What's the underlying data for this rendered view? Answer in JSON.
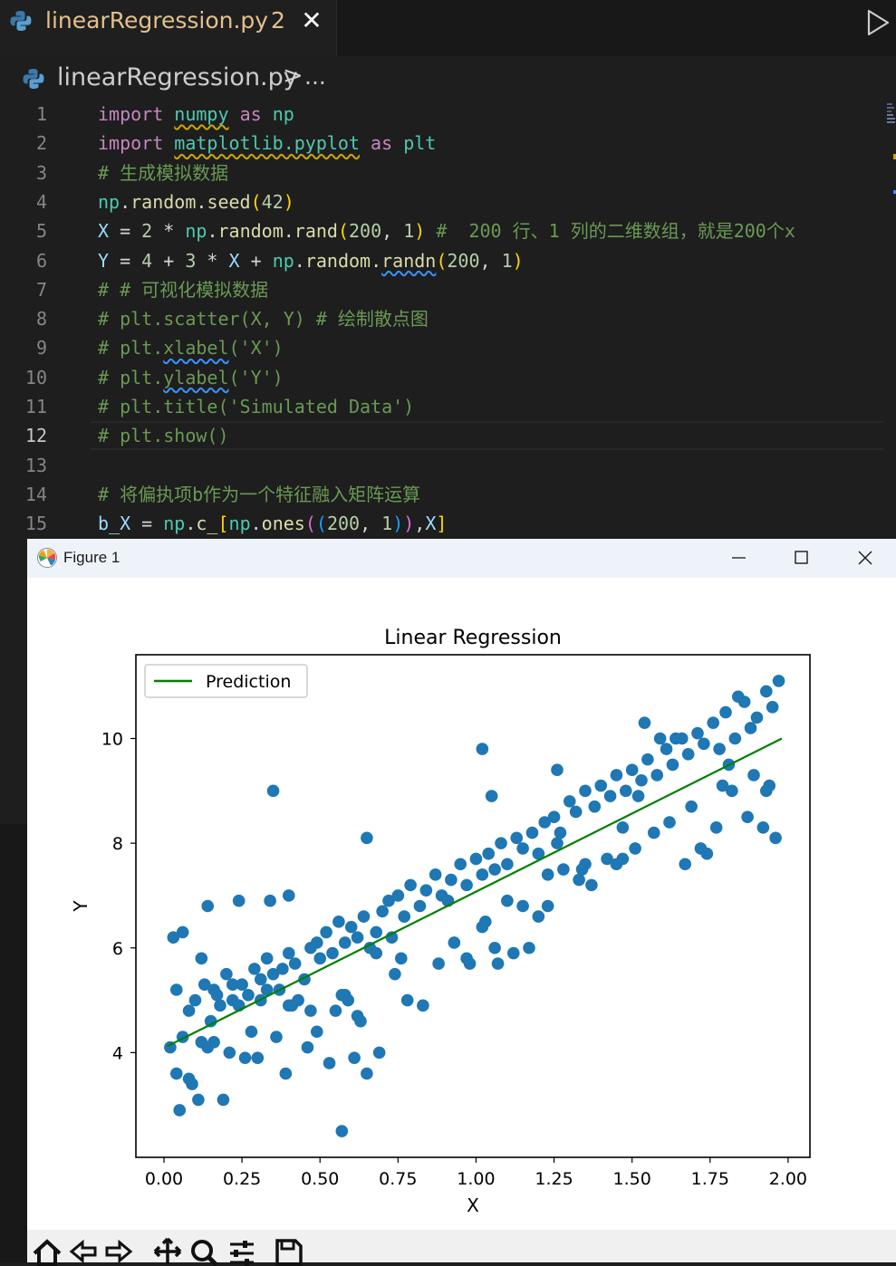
{
  "editor": {
    "tab": {
      "title": "linearRegression.py",
      "badge": "2",
      "close": "✕"
    },
    "breadcrumb": {
      "file": "linearRegression.py",
      "separator": ">",
      "ellipsis": "..."
    },
    "active_line": "12",
    "lines": [
      {
        "n": "1",
        "s": [
          [
            "kw",
            "import"
          ],
          [
            "op",
            " "
          ],
          [
            "mod sqy",
            "numpy"
          ],
          [
            "op",
            " "
          ],
          [
            "kw",
            "as"
          ],
          [
            "op",
            " "
          ],
          [
            "mod",
            "np"
          ]
        ]
      },
      {
        "n": "2",
        "s": [
          [
            "kw",
            "import"
          ],
          [
            "op",
            " "
          ],
          [
            "mod sqy",
            "matplotlib.pyplot"
          ],
          [
            "op",
            " "
          ],
          [
            "kw",
            "as"
          ],
          [
            "op",
            " "
          ],
          [
            "mod",
            "plt"
          ]
        ]
      },
      {
        "n": "3",
        "s": [
          [
            "cmt",
            "# 生成模拟数据"
          ]
        ]
      },
      {
        "n": "4",
        "s": [
          [
            "mod",
            "np"
          ],
          [
            "op",
            "."
          ],
          [
            "fn",
            "random"
          ],
          [
            "op",
            "."
          ],
          [
            "fn",
            "seed"
          ],
          [
            "b1",
            "("
          ],
          [
            "num",
            "42"
          ],
          [
            "b1",
            ")"
          ]
        ]
      },
      {
        "n": "5",
        "s": [
          [
            "var",
            "X"
          ],
          [
            "op",
            " = "
          ],
          [
            "num",
            "2"
          ],
          [
            "op",
            " * "
          ],
          [
            "mod",
            "np"
          ],
          [
            "op",
            "."
          ],
          [
            "fn",
            "random"
          ],
          [
            "op",
            "."
          ],
          [
            "fn",
            "rand"
          ],
          [
            "b1",
            "("
          ],
          [
            "num",
            "200"
          ],
          [
            "op",
            ", "
          ],
          [
            "num",
            "1"
          ],
          [
            "b1",
            ")"
          ],
          [
            "cmt",
            " #  200 行、1 列的二维数组，就是200个x"
          ]
        ]
      },
      {
        "n": "6",
        "s": [
          [
            "var",
            "Y"
          ],
          [
            "op",
            " = "
          ],
          [
            "num",
            "4"
          ],
          [
            "op",
            " + "
          ],
          [
            "num",
            "3"
          ],
          [
            "op",
            " * "
          ],
          [
            "var",
            "X"
          ],
          [
            "op",
            " + "
          ],
          [
            "mod",
            "np"
          ],
          [
            "op",
            "."
          ],
          [
            "fn",
            "random"
          ],
          [
            "op",
            "."
          ],
          [
            "fn sqb",
            "randn"
          ],
          [
            "b1",
            "("
          ],
          [
            "num",
            "200"
          ],
          [
            "op",
            ", "
          ],
          [
            "num",
            "1"
          ],
          [
            "b1",
            ")"
          ]
        ]
      },
      {
        "n": "7",
        "s": [
          [
            "cmt",
            "# # 可视化模拟数据"
          ]
        ]
      },
      {
        "n": "8",
        "s": [
          [
            "cmt",
            "# plt.scatter(X, Y) # 绘制散点图"
          ]
        ]
      },
      {
        "n": "9",
        "s": [
          [
            "cmt",
            "# plt."
          ],
          [
            "cmt sqb",
            "xlabel"
          ],
          [
            "cmt",
            "('X')"
          ]
        ]
      },
      {
        "n": "10",
        "s": [
          [
            "cmt",
            "# plt."
          ],
          [
            "cmt sqb",
            "ylabel"
          ],
          [
            "cmt",
            "('Y')"
          ]
        ]
      },
      {
        "n": "11",
        "s": [
          [
            "cmt",
            "# plt.title('Simulated Data')"
          ]
        ]
      },
      {
        "n": "12",
        "s": [
          [
            "cmt",
            "# plt.show()"
          ]
        ]
      },
      {
        "n": "13",
        "s": []
      },
      {
        "n": "14",
        "s": [
          [
            "cmt",
            "# 将偏执项b作为一个特征融入矩阵运算"
          ]
        ]
      },
      {
        "n": "15",
        "s": [
          [
            "var",
            "b_X"
          ],
          [
            "op",
            " = "
          ],
          [
            "mod",
            "np"
          ],
          [
            "op",
            "."
          ],
          [
            "fn",
            "c_"
          ],
          [
            "b1",
            "["
          ],
          [
            "mod",
            "np"
          ],
          [
            "op",
            "."
          ],
          [
            "fn",
            "ones"
          ],
          [
            "b2",
            "("
          ],
          [
            "b3",
            "("
          ],
          [
            "num",
            "200"
          ],
          [
            "op",
            ", "
          ],
          [
            "num",
            "1"
          ],
          [
            "b3",
            ")"
          ],
          [
            "b2",
            ")"
          ],
          [
            "op",
            ","
          ],
          [
            "var",
            "X"
          ],
          [
            "b1",
            "]"
          ]
        ]
      }
    ]
  },
  "figure": {
    "window_title": "Figure 1",
    "minimize": "—",
    "maximize": "☐",
    "close": "✕",
    "toolbar": [
      "home-icon",
      "back-icon",
      "forward-icon",
      "pan-icon",
      "zoom-icon",
      "configure-icon",
      "save-icon"
    ]
  },
  "chart_data": {
    "type": "scatter",
    "title": "Linear Regression",
    "xlabel": "X",
    "ylabel": "Y",
    "xlim": [
      -0.09,
      2.07
    ],
    "ylim": [
      2.0,
      11.6
    ],
    "xticks": [
      "0.00",
      "0.25",
      "0.50",
      "0.75",
      "1.00",
      "1.25",
      "1.50",
      "1.75",
      "2.00"
    ],
    "yticks": [
      "4",
      "6",
      "8",
      "10"
    ],
    "legend": {
      "entries": [
        "Prediction"
      ],
      "position": "upper left"
    },
    "colors": {
      "points": "#1f77b4",
      "line": "#008000"
    },
    "series": [
      {
        "type": "line",
        "name": "Prediction",
        "x": [
          0.01,
          1.98
        ],
        "y": [
          4.12,
          10.0
        ]
      },
      {
        "type": "scatter",
        "x": [
          0.02,
          0.04,
          0.06,
          0.08,
          0.1,
          0.12,
          0.13,
          0.15,
          0.17,
          0.18,
          0.2,
          0.22,
          0.24,
          0.25,
          0.27,
          0.29,
          0.31,
          0.33,
          0.35,
          0.37,
          0.38,
          0.4,
          0.42,
          0.45,
          0.47,
          0.49,
          0.5,
          0.52,
          0.54,
          0.56,
          0.58,
          0.6,
          0.62,
          0.64,
          0.66,
          0.68,
          0.7,
          0.72,
          0.75,
          0.77,
          0.79,
          0.82,
          0.84,
          0.87,
          0.89,
          0.92,
          0.95,
          0.97,
          1.0,
          1.02,
          1.04,
          1.06,
          1.08,
          1.1,
          1.13,
          1.15,
          1.18,
          1.2,
          1.22,
          1.25,
          1.27,
          1.3,
          1.32,
          1.35,
          1.38,
          1.4,
          1.43,
          1.45,
          1.48,
          1.5,
          1.53,
          1.55,
          1.58,
          1.61,
          1.63,
          1.66,
          1.68,
          1.71,
          1.73,
          1.76,
          1.78,
          1.8,
          1.83,
          1.86,
          1.88,
          1.9,
          1.93,
          1.95,
          1.97,
          0.03,
          0.05,
          0.09,
          0.11,
          0.14,
          0.16,
          0.21,
          0.26,
          0.3,
          0.34,
          0.39,
          0.43,
          0.46,
          0.53,
          0.57,
          0.61,
          0.65,
          0.69,
          0.74,
          0.78,
          0.83,
          0.88,
          0.93,
          0.98,
          1.03,
          1.07,
          1.12,
          1.17,
          1.23,
          1.28,
          1.33,
          1.37,
          1.42,
          1.47,
          1.52,
          1.57,
          1.62,
          1.67,
          1.72,
          1.77,
          1.82,
          1.87,
          1.92,
          1.96,
          0.08,
          0.19,
          0.28,
          0.4,
          0.55,
          0.63,
          1.02,
          1.05,
          1.51,
          1.74,
          1.89,
          0.58,
          0.65,
          0.97,
          1.26,
          1.45,
          1.59,
          1.79,
          1.94,
          0.47,
          0.36,
          0.24,
          0.14,
          0.06,
          0.68,
          0.35,
          0.4,
          1.26,
          1.81,
          1.69,
          1.35,
          1.2,
          1.1,
          1.02,
          0.91,
          0.76,
          0.62,
          0.59,
          0.49,
          0.41,
          0.33,
          0.22,
          0.12,
          0.04,
          1.15,
          1.34,
          1.54,
          1.64,
          1.84,
          1.93,
          0.16,
          0.31,
          0.57,
          0.73,
          1.06,
          1.23,
          1.47
        ],
        "y": [
          4.1,
          5.2,
          4.3,
          4.8,
          5.0,
          4.2,
          5.3,
          4.6,
          5.1,
          4.9,
          5.5,
          5.0,
          4.9,
          5.3,
          5.1,
          5.6,
          5.4,
          5.8,
          5.5,
          5.2,
          5.6,
          5.9,
          5.7,
          5.4,
          6.0,
          6.1,
          5.8,
          6.3,
          5.9,
          6.5,
          6.1,
          6.4,
          6.2,
          6.6,
          6.0,
          6.3,
          6.7,
          6.9,
          7.0,
          6.6,
          7.2,
          6.8,
          7.1,
          7.4,
          7.0,
          7.3,
          7.6,
          7.2,
          7.7,
          7.4,
          7.8,
          7.5,
          8.0,
          7.6,
          8.1,
          7.9,
          8.2,
          7.8,
          8.4,
          8.5,
          8.2,
          8.8,
          8.6,
          9.0,
          8.7,
          9.1,
          8.9,
          9.3,
          9.0,
          9.4,
          9.2,
          9.6,
          9.3,
          9.8,
          9.5,
          10.0,
          9.7,
          10.1,
          9.9,
          10.3,
          9.8,
          10.5,
          10.0,
          10.7,
          10.2,
          10.4,
          10.9,
          10.6,
          11.1,
          6.2,
          2.9,
          3.4,
          3.1,
          6.8,
          4.2,
          4.0,
          3.9,
          3.9,
          6.9,
          3.6,
          5.0,
          4.1,
          3.8,
          2.5,
          3.9,
          3.6,
          4.0,
          5.5,
          5.0,
          4.9,
          5.7,
          6.1,
          5.7,
          6.5,
          5.7,
          5.9,
          6.0,
          7.4,
          7.5,
          7.3,
          7.2,
          7.7,
          8.3,
          8.9,
          8.2,
          8.4,
          7.6,
          7.9,
          8.3,
          9.0,
          8.5,
          8.3,
          8.1,
          3.5,
          3.1,
          4.4,
          4.9,
          4.8,
          4.6,
          9.8,
          8.9,
          7.9,
          7.8,
          9.3,
          5.1,
          8.1,
          5.8,
          8.0,
          7.6,
          10.0,
          9.1,
          9.1,
          4.8,
          4.3,
          6.9,
          4.1,
          6.3,
          5.9,
          9.0,
          7.0,
          9.4,
          9.5,
          8.7,
          7.6,
          6.6,
          6.9,
          6.4,
          6.9,
          5.8,
          4.7,
          5.0,
          4.4,
          4.9,
          5.2,
          5.3,
          5.8,
          3.6,
          6.8,
          7.5,
          10.3,
          10.0,
          10.8,
          9.0,
          5.2,
          5.0,
          5.1,
          6.2,
          6.0,
          6.8,
          7.7
        ]
      }
    ]
  }
}
